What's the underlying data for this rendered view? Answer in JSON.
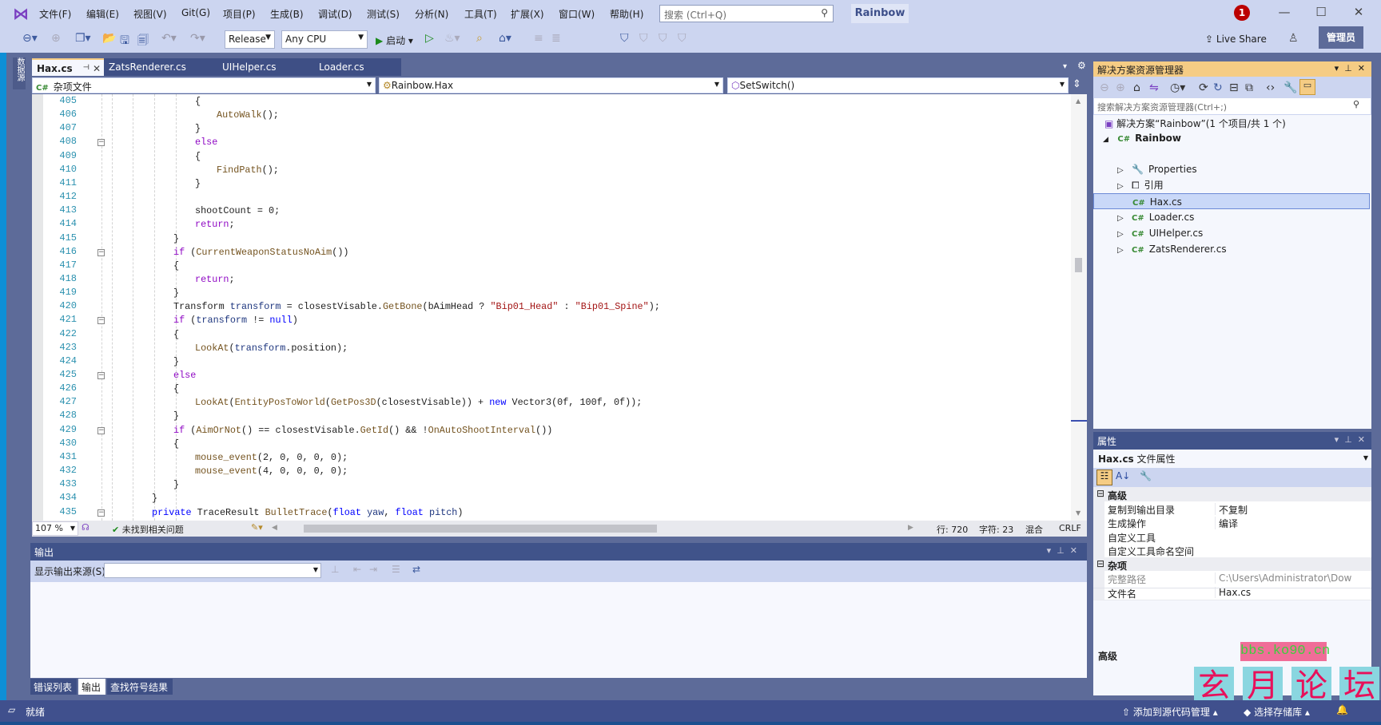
{
  "titlebar": {
    "menu": [
      "文件(F)",
      "编辑(E)",
      "视图(V)",
      "Git(G)",
      "项目(P)",
      "生成(B)",
      "调试(D)",
      "测试(S)",
      "分析(N)",
      "工具(T)",
      "扩展(X)",
      "窗口(W)",
      "帮助(H)"
    ],
    "search_placeholder": "搜索 (Ctrl+Q)",
    "solution_name": "Rainbow",
    "notification_count": "1"
  },
  "toolbar": {
    "configuration": "Release",
    "platform": "Any CPU",
    "start_label": "启动",
    "live_share": "Live Share",
    "admin": "管理员"
  },
  "tabs": [
    {
      "label": "Hax.cs",
      "active": true
    },
    {
      "label": "ZatsRenderer.cs"
    },
    {
      "label": "UIHelper.cs"
    },
    {
      "label": "Loader.cs"
    }
  ],
  "side_strip_label": "数据源",
  "navbar": {
    "project": "杂项文件",
    "type": "Rainbow.Hax",
    "member": "SetSwitch()"
  },
  "code_colors": {
    "kw": "#8f08c4",
    "blue": "#0000ff",
    "method": "#74531f",
    "str": "#a31515",
    "id": "#1f377f",
    "plain": "#1e1e1e",
    "type": "#2b91af"
  },
  "code": [
    {
      "n": "405",
      "i": 2,
      "t": [
        [
          "{",
          "plain"
        ]
      ]
    },
    {
      "n": "406",
      "i": 3,
      "t": [
        [
          "AutoWalk",
          "method"
        ],
        [
          "();",
          "plain"
        ]
      ]
    },
    {
      "n": "407",
      "i": 2,
      "t": [
        [
          "}",
          "plain"
        ]
      ]
    },
    {
      "n": "408",
      "i": 2,
      "t": [
        [
          "else",
          "kw"
        ]
      ],
      "f": true
    },
    {
      "n": "409",
      "i": 2,
      "t": [
        [
          "{",
          "plain"
        ]
      ]
    },
    {
      "n": "410",
      "i": 3,
      "t": [
        [
          "FindPath",
          "method"
        ],
        [
          "();",
          "plain"
        ]
      ]
    },
    {
      "n": "411",
      "i": 2,
      "t": [
        [
          "}",
          "plain"
        ]
      ]
    },
    {
      "n": "412",
      "i": 0,
      "t": []
    },
    {
      "n": "413",
      "i": 2,
      "t": [
        [
          "shootCount = 0;",
          "plain"
        ]
      ]
    },
    {
      "n": "414",
      "i": 2,
      "t": [
        [
          "return",
          "kw"
        ],
        [
          ";",
          "plain"
        ]
      ]
    },
    {
      "n": "415",
      "i": 1,
      "t": [
        [
          "}",
          "plain"
        ]
      ]
    },
    {
      "n": "416",
      "i": 1,
      "t": [
        [
          "if",
          "kw"
        ],
        [
          " (",
          "plain"
        ],
        [
          "CurrentWeaponStatusNoAim",
          "method"
        ],
        [
          "())",
          "plain"
        ]
      ],
      "f": true
    },
    {
      "n": "417",
      "i": 1,
      "t": [
        [
          "{",
          "plain"
        ]
      ]
    },
    {
      "n": "418",
      "i": 2,
      "t": [
        [
          "return",
          "kw"
        ],
        [
          ";",
          "plain"
        ]
      ]
    },
    {
      "n": "419",
      "i": 1,
      "t": [
        [
          "}",
          "plain"
        ]
      ]
    },
    {
      "n": "420",
      "i": 1,
      "t": [
        [
          "Transform ",
          "plain"
        ],
        [
          "transform",
          "id"
        ],
        [
          " = closestVisable.",
          "plain"
        ],
        [
          "GetBone",
          "method"
        ],
        [
          "(bAimHead ? ",
          "plain"
        ],
        [
          "\"Bip01_Head\"",
          "str"
        ],
        [
          " : ",
          "plain"
        ],
        [
          "\"Bip01_Spine\"",
          "str"
        ],
        [
          ");",
          "plain"
        ]
      ]
    },
    {
      "n": "421",
      "i": 1,
      "t": [
        [
          "if",
          "kw"
        ],
        [
          " (",
          "plain"
        ],
        [
          "transform",
          "id"
        ],
        [
          " != ",
          "plain"
        ],
        [
          "null",
          "blue"
        ],
        [
          ")",
          "plain"
        ]
      ],
      "f": true
    },
    {
      "n": "422",
      "i": 1,
      "t": [
        [
          "{",
          "plain"
        ]
      ]
    },
    {
      "n": "423",
      "i": 2,
      "t": [
        [
          "LookAt",
          "method"
        ],
        [
          "(",
          "plain"
        ],
        [
          "transform",
          "id"
        ],
        [
          ".position);",
          "plain"
        ]
      ]
    },
    {
      "n": "424",
      "i": 1,
      "t": [
        [
          "}",
          "plain"
        ]
      ]
    },
    {
      "n": "425",
      "i": 1,
      "t": [
        [
          "else",
          "kw"
        ]
      ],
      "f": true
    },
    {
      "n": "426",
      "i": 1,
      "t": [
        [
          "{",
          "plain"
        ]
      ]
    },
    {
      "n": "427",
      "i": 2,
      "t": [
        [
          "LookAt",
          "method"
        ],
        [
          "(",
          "plain"
        ],
        [
          "EntityPosToWorld",
          "method"
        ],
        [
          "(",
          "plain"
        ],
        [
          "GetPos3D",
          "method"
        ],
        [
          "(closestVisable)) + ",
          "plain"
        ],
        [
          "new",
          "blue"
        ],
        [
          " Vector3(0f, 100f, 0f));",
          "plain"
        ]
      ]
    },
    {
      "n": "428",
      "i": 1,
      "t": [
        [
          "}",
          "plain"
        ]
      ]
    },
    {
      "n": "429",
      "i": 1,
      "t": [
        [
          "if",
          "kw"
        ],
        [
          " (",
          "plain"
        ],
        [
          "AimOrNot",
          "method"
        ],
        [
          "() == closestVisable.",
          "plain"
        ],
        [
          "GetId",
          "method"
        ],
        [
          "() && !",
          "plain"
        ],
        [
          "OnAutoShootInterval",
          "method"
        ],
        [
          "())",
          "plain"
        ]
      ],
      "f": true
    },
    {
      "n": "430",
      "i": 1,
      "t": [
        [
          "{",
          "plain"
        ]
      ]
    },
    {
      "n": "431",
      "i": 2,
      "t": [
        [
          "mouse_event",
          "method"
        ],
        [
          "(2, 0, 0, 0, 0);",
          "plain"
        ]
      ]
    },
    {
      "n": "432",
      "i": 2,
      "t": [
        [
          "mouse_event",
          "method"
        ],
        [
          "(4, 0, 0, 0, 0);",
          "plain"
        ]
      ]
    },
    {
      "n": "433",
      "i": 1,
      "t": [
        [
          "}",
          "plain"
        ]
      ]
    },
    {
      "n": "434",
      "i": 0,
      "t": [
        [
          "}",
          "plain"
        ]
      ]
    },
    {
      "n": "435",
      "i": 0,
      "t": [
        [
          "private",
          "blue"
        ],
        [
          " TraceResult ",
          "plain"
        ],
        [
          "BulletTrace",
          "method"
        ],
        [
          "(",
          "plain"
        ],
        [
          "float",
          "blue"
        ],
        [
          " ",
          "plain"
        ],
        [
          "yaw",
          "id"
        ],
        [
          ", ",
          "plain"
        ],
        [
          "float",
          "blue"
        ],
        [
          " ",
          "plain"
        ],
        [
          "pitch",
          "id"
        ],
        [
          ")",
          "plain"
        ]
      ],
      "f": true
    }
  ],
  "editor_status": {
    "zoom": "107 %",
    "issues": "未找到相关问题",
    "line": "行: 720",
    "char": "字符: 23",
    "mode": "混合",
    "eol": "CRLF"
  },
  "output": {
    "title": "输出",
    "source_label": "显示输出来源(S):",
    "source_value": ""
  },
  "bottom_tabs": [
    "错误列表",
    "输出",
    "查找符号结果"
  ],
  "statusbar": {
    "ready": "就绪",
    "add_source": "添加到源代码管理",
    "select_repo": "选择存储库"
  },
  "solution_explorer": {
    "title": "解决方案资源管理器",
    "search_placeholder": "搜索解决方案资源管理器(Ctrl+;)",
    "solution": "解决方案“Rainbow”(1 个项目/共 1 个)",
    "project": "Rainbow",
    "items": [
      {
        "label": "Properties",
        "icon": "wrench-icon",
        "expandable": true
      },
      {
        "label": "引用",
        "icon": "references-icon",
        "expandable": true
      },
      {
        "label": "Hax.cs",
        "icon": "csharp-icon",
        "selected": true
      },
      {
        "label": "Loader.cs",
        "icon": "csharp-icon",
        "expandable": true
      },
      {
        "label": "UIHelper.cs",
        "icon": "csharp-icon",
        "expandable": true
      },
      {
        "label": "ZatsRenderer.cs",
        "icon": "csharp-icon",
        "expandable": true
      }
    ]
  },
  "properties": {
    "title": "属性",
    "object": "Hax.cs",
    "object_type": "文件属性",
    "categories": [
      {
        "name": "高级",
        "rows": [
          [
            "复制到输出目录",
            "不复制"
          ],
          [
            "生成操作",
            "编译"
          ],
          [
            "自定义工具",
            ""
          ],
          [
            "自定义工具命名空间",
            ""
          ]
        ]
      },
      {
        "name": "杂项",
        "rows": [
          [
            "完整路径",
            "C:\\Users\\Administrator\\Downl"
          ],
          [
            "文件名",
            "Hax.cs"
          ]
        ]
      }
    ],
    "description_title": "高级"
  },
  "watermark": {
    "url": "bbs.ko90.cn",
    "chars": [
      "玄",
      "月",
      "论",
      "坛"
    ]
  }
}
